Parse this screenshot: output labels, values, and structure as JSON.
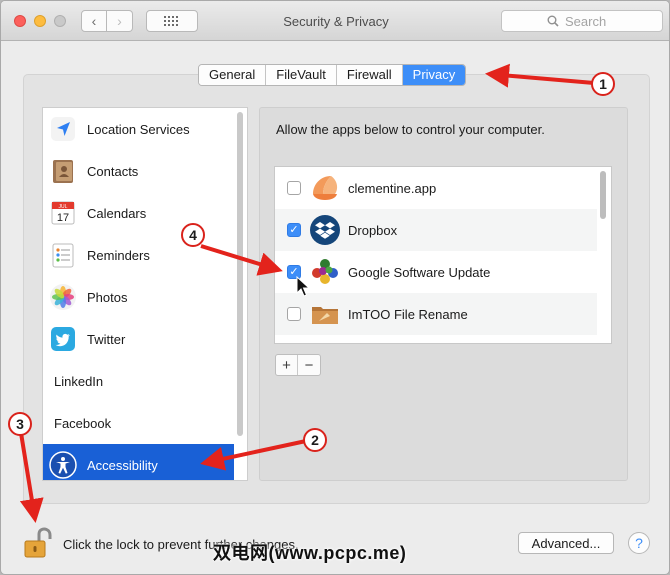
{
  "window": {
    "title": "Security & Privacy",
    "search": {
      "placeholder": "Search"
    }
  },
  "tabs": [
    {
      "label": "General",
      "active": false
    },
    {
      "label": "FileVault",
      "active": false
    },
    {
      "label": "Firewall",
      "active": false
    },
    {
      "label": "Privacy",
      "active": true
    }
  ],
  "sidebar": {
    "items": [
      {
        "label": "Location Services",
        "icon": "location-arrow-icon"
      },
      {
        "label": "Contacts",
        "icon": "contacts-book-icon"
      },
      {
        "label": "Calendars",
        "icon": "calendar-icon",
        "icon_text": {
          "month": "JUL",
          "day": "17"
        }
      },
      {
        "label": "Reminders",
        "icon": "reminders-list-icon"
      },
      {
        "label": "Photos",
        "icon": "photos-flower-icon"
      },
      {
        "label": "Twitter",
        "icon": "twitter-bird-icon"
      },
      {
        "label": "LinkedIn",
        "icon": ""
      },
      {
        "label": "Facebook",
        "icon": ""
      },
      {
        "label": "Accessibility",
        "icon": "accessibility-icon",
        "selected": true
      }
    ]
  },
  "panel": {
    "description": "Allow the apps below to control your computer.",
    "apps": [
      {
        "name": "clementine.app",
        "checked": false,
        "icon": "clementine-icon"
      },
      {
        "name": "Dropbox",
        "checked": true,
        "icon": "dropbox-icon"
      },
      {
        "name": "Google Software Update",
        "checked": true,
        "icon": "google-update-balls-icon"
      },
      {
        "name": "ImTOO File Rename",
        "checked": false,
        "icon": "folder-icon"
      }
    ],
    "add_label": "+",
    "remove_label": "−"
  },
  "footer": {
    "lock_text": "Click the lock to prevent further changes.",
    "advanced_label": "Advanced...",
    "help_label": "?"
  },
  "callouts": [
    "1",
    "2",
    "3",
    "4"
  ],
  "watermark": "双电网(www.pcpc.me)",
  "colors": {
    "selection": "#1960d6",
    "accent": "#3d8ef8",
    "arrow": "#e3231c"
  }
}
